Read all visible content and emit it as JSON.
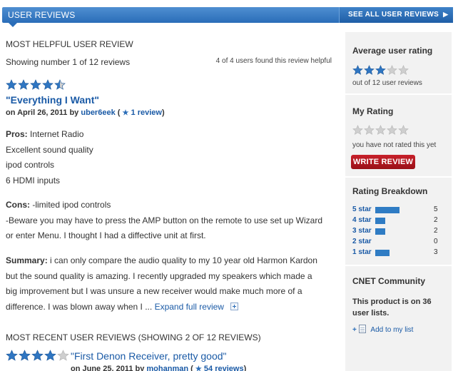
{
  "header": {
    "title": "USER REVIEWS",
    "see_all": "SEE ALL USER REVIEWS",
    "see_all_icon": "triangle-right-icon"
  },
  "most_helpful": {
    "section_label": "MOST HELPFUL USER REVIEW",
    "showing": "Showing number 1 of 12 reviews",
    "helpful": "4 of 4 users found this review helpful",
    "rating": 4.5,
    "title": "\"Everything I Want\"",
    "date_prefix": "on April 26, 2011 by",
    "author": "uber6eek",
    "review_count": "1 review",
    "pros_label": "Pros:",
    "pros_lines": [
      "Internet Radio",
      "Excellent sound quality",
      "ipod controls",
      "6 HDMI inputs"
    ],
    "cons_label": "Cons:",
    "cons_lines": [
      "-limited ipod controls",
      "-Beware you may have to press the AMP button on the remote to use set up Wizard",
      "or enter Menu. I thought I had a diffective unit at first."
    ],
    "summary_label": "Summary:",
    "summary_lines": [
      "i can only compare the audio quality to my 10 year old Harmon Kardon",
      "but the sound quality is amazing. I recently upgraded my speakers which made a",
      "big improvement but I was unsure a new receiver would make much more of a",
      "difference. I was blown away when I ..."
    ],
    "expand_label": "Expand full review"
  },
  "most_recent": {
    "section_label": "MOST RECENT USER REVIEWS (SHOWING 2 OF 12 REVIEWS)",
    "rating": 4,
    "title": "\"First Denon Receiver, pretty good\"",
    "date_prefix": "on June 25, 2011 by",
    "author": "mohanman",
    "review_count": "54 reviews"
  },
  "sidebar": {
    "avg_heading": "Average user rating",
    "avg_rating": 3,
    "avg_caption": "out of 12 user reviews",
    "my_heading": "My Rating",
    "my_rating": 0,
    "my_caption": "you have not rated this yet",
    "write_button": "WRITE REVIEW",
    "breakdown_heading": "Rating Breakdown",
    "breakdown": [
      {
        "label": "5 star",
        "count": "5",
        "fraction": 0.42
      },
      {
        "label": "4 star",
        "count": "2",
        "fraction": 0.17
      },
      {
        "label": "3 star",
        "count": "2",
        "fraction": 0.17
      },
      {
        "label": "2 star",
        "count": "0",
        "fraction": 0.0
      },
      {
        "label": "1 star",
        "count": "3",
        "fraction": 0.25
      }
    ],
    "community_heading": "CNET Community",
    "community_text": "This product is on 36",
    "community_link": "user lists.",
    "add_link": "Add to my list"
  },
  "colors": {
    "star_filled": "#2f76c2",
    "star_empty": "#cfcfcf",
    "accent": "#1a5aa6",
    "header": "#2a6db8",
    "button": "#b01820"
  }
}
